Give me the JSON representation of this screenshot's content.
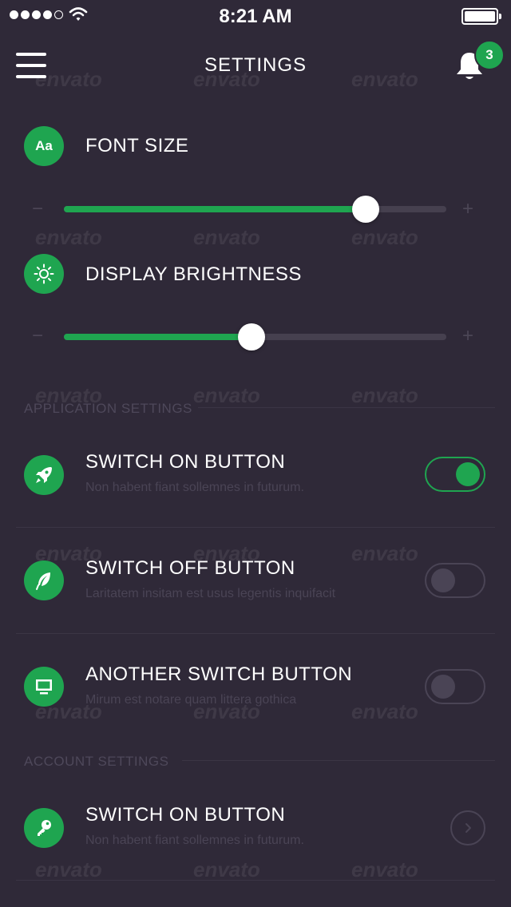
{
  "status_bar": {
    "time": "8:21 AM",
    "signal_icon": "signal-dots-icon",
    "wifi_icon": "wifi-icon",
    "battery_icon": "battery-full-icon"
  },
  "header": {
    "title": "SETTINGS",
    "menu_icon": "hamburger-menu-icon",
    "bell_icon": "bell-icon",
    "notification_count": "3"
  },
  "sliders": {
    "font_size": {
      "icon_text": "Aa",
      "label": "FONT SIZE",
      "minus": "−",
      "plus": "+",
      "value_fraction": 0.79
    },
    "brightness": {
      "icon": "sun-icon",
      "label": "DISPLAY BRIGHTNESS",
      "minus": "−",
      "plus": "+",
      "value_fraction": 0.49
    }
  },
  "application_settings": {
    "section_label": "APPLICATION SETTINGS",
    "items": [
      {
        "icon": "rocket-icon",
        "title": "SWITCH ON BUTTON",
        "subtitle": "Non habent fiant sollemnes in futurum.",
        "state": "on"
      },
      {
        "icon": "feather-icon",
        "title": "SWITCH OFF BUTTON",
        "subtitle": "Laritatem insitam est usus legentis inquifacit",
        "state": "off"
      },
      {
        "icon": "monitor-icon",
        "title": "ANOTHER SWITCH BUTTON",
        "subtitle": "Mirum est notare quam littera gothica",
        "state": "off"
      }
    ]
  },
  "account_settings": {
    "section_label": "ACCOUNT SETTINGS",
    "items": [
      {
        "icon": "key-icon",
        "title": "SWITCH ON BUTTON",
        "subtitle": "Non habent fiant sollemnes in futurum.",
        "action_icon": "chevron-right-icon"
      }
    ]
  },
  "watermark": "envato",
  "colors": {
    "background": "#2f2938",
    "accent": "#1fa550",
    "muted": "#4a4455"
  }
}
